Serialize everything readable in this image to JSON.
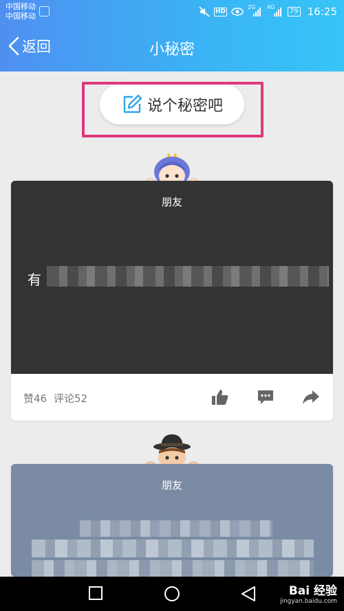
{
  "status_bar": {
    "carrier_1": "中国移动",
    "carrier_2": "中国移动",
    "hd": "HD",
    "net_1": "2G",
    "net_2": "4G",
    "battery": "79",
    "time": "16:25"
  },
  "nav": {
    "back_label": "返回",
    "title": "小秘密"
  },
  "compose": {
    "label": "说个秘密吧"
  },
  "posts": [
    {
      "tag": "朋友",
      "text_visible": "有",
      "likes": "赞46",
      "comments": "评论52"
    },
    {
      "tag": "朋友"
    }
  ],
  "watermark": {
    "brand": "Bai 经验",
    "url": "jingyan.baidu.com"
  },
  "colors": {
    "header_gradient_start": "#4f8ff0",
    "header_gradient_end": "#37c4f6",
    "highlight_frame": "#e0377c",
    "card1_bg": "#333333",
    "card2_bg": "#7a8ba3"
  }
}
